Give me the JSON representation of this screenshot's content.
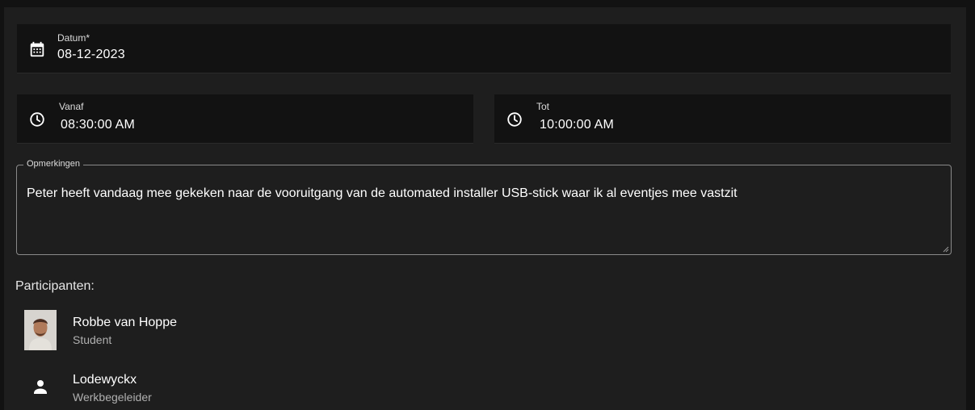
{
  "datum": {
    "label": "Datum*",
    "value": "08-12-2023",
    "icon": "calendar-icon"
  },
  "vanaf": {
    "label": "Vanaf",
    "value": "08:30:00  AM",
    "icon": "clock-icon"
  },
  "tot": {
    "label": "Tot",
    "value": "10:00:00  AM",
    "icon": "clock-icon"
  },
  "opmerkingen": {
    "label": "Opmerkingen",
    "value": "Peter heeft vandaag mee gekeken naar de vooruitgang van de automated installer USB-stick waar ik al eventjes mee vastzit"
  },
  "participants": {
    "title": "Participanten:",
    "items": [
      {
        "name": "Robbe van Hoppe",
        "role": "Student",
        "avatar": "photo"
      },
      {
        "name": "Lodewyckx",
        "role": "Werkbegeleider",
        "avatar": "person-icon"
      }
    ]
  },
  "colors": {
    "page_background": "#121212",
    "panel_background": "#1e1e1e",
    "field_background": "#121212",
    "text_primary": "#ffffff",
    "text_secondary": "#b0b0b0",
    "outline": "#8a8a8a"
  }
}
